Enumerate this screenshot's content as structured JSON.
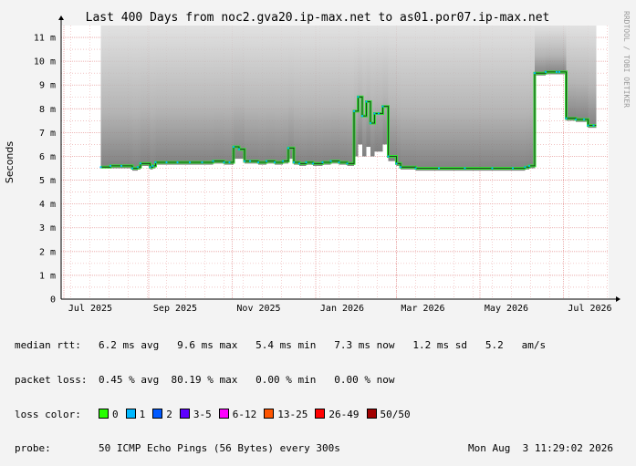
{
  "chart_data": {
    "type": "area",
    "title": "Last 400 Days from noc2.gva20.ip-max.net to as01.por07.ip-max.net",
    "ylabel": "Seconds",
    "vendor_label": "RRDTOOL / TOBI OETIKER",
    "ylim": [
      0,
      11.5
    ],
    "y_ticks": [
      {
        "value": 0,
        "label": "0"
      },
      {
        "value": 1,
        "label": "1 m"
      },
      {
        "value": 2,
        "label": "2 m"
      },
      {
        "value": 3,
        "label": "3 m"
      },
      {
        "value": 4,
        "label": "4 m"
      },
      {
        "value": 5,
        "label": "5 m"
      },
      {
        "value": 6,
        "label": "6 m"
      },
      {
        "value": 7,
        "label": "7 m"
      },
      {
        "value": 8,
        "label": "8 m"
      },
      {
        "value": 9,
        "label": "9 m"
      },
      {
        "value": 10,
        "label": "10 m"
      },
      {
        "value": 11,
        "label": "11 m"
      }
    ],
    "x_ticks": [
      {
        "date": "2025-07-01",
        "label": "Jul 2025"
      },
      {
        "date": "2025-09-01",
        "label": "Sep 2025"
      },
      {
        "date": "2025-11-01",
        "label": "Nov 2025"
      },
      {
        "date": "2026-01-01",
        "label": "Jan 2026"
      },
      {
        "date": "2026-03-01",
        "label": "Mar 2026"
      },
      {
        "date": "2026-05-01",
        "label": "May 2026"
      },
      {
        "date": "2026-07-01",
        "label": "Jul 2026"
      }
    ],
    "xlim": [
      "2025-06-29",
      "2026-08-03"
    ],
    "grid": true,
    "grid_color": "#e8a0a0",
    "median_color": "#33dd33",
    "series": [
      {
        "date": [
          "2025-07-28",
          "2025-08-04",
          "2025-08-12",
          "2025-08-20",
          "2025-08-24",
          "2025-08-26",
          "2025-09-02",
          "2025-09-04",
          "2025-09-06",
          "2025-09-14",
          "2025-09-22",
          "2025-10-01",
          "2025-10-10",
          "2025-10-18",
          "2025-10-26",
          "2025-10-30",
          "2025-11-02",
          "2025-11-06",
          "2025-11-10",
          "2025-11-14",
          "2025-11-20",
          "2025-11-26",
          "2025-12-02",
          "2025-12-08",
          "2025-12-12",
          "2025-12-16",
          "2025-12-20",
          "2025-12-25",
          "2025-12-30",
          "2026-01-06",
          "2026-01-12",
          "2026-01-18",
          "2026-01-24",
          "2026-01-29",
          "2026-02-01",
          "2026-02-04",
          "2026-02-07",
          "2026-02-10",
          "2026-02-13",
          "2026-02-16",
          "2026-02-19",
          "2026-02-23",
          "2026-03-01",
          "2026-03-04",
          "2026-03-15",
          "2026-04-01",
          "2026-04-20",
          "2026-05-10",
          "2026-05-25",
          "2026-06-03",
          "2026-06-06",
          "2026-06-10",
          "2026-06-18",
          "2026-06-26",
          "2026-06-28",
          "2026-07-03",
          "2026-07-10",
          "2026-07-16",
          "2026-07-19",
          "2026-07-23"
        ],
        "median": [
          5.55,
          5.6,
          5.6,
          5.5,
          5.55,
          5.7,
          5.55,
          5.6,
          5.75,
          5.75,
          5.75,
          5.75,
          5.75,
          5.8,
          5.75,
          5.75,
          6.4,
          6.3,
          5.8,
          5.8,
          5.75,
          5.8,
          5.75,
          5.8,
          6.35,
          5.75,
          5.7,
          5.75,
          5.7,
          5.75,
          5.8,
          5.75,
          5.7,
          7.9,
          8.5,
          7.7,
          8.3,
          7.4,
          7.8,
          7.8,
          8.1,
          6.0,
          5.7,
          5.55,
          5.5,
          5.5,
          5.5,
          5.5,
          5.5,
          5.55,
          5.6,
          9.5,
          9.55,
          9.55,
          9.55,
          7.6,
          7.55,
          7.55,
          7.3,
          7.3
        ],
        "upper": [
          11.5,
          11.5,
          11.5,
          11.5,
          11.5,
          11.5,
          11.5,
          11.5,
          11.5,
          11.5,
          11.5,
          11.5,
          11.5,
          11.5,
          11.5,
          11.5,
          11.5,
          11.5,
          11.5,
          11.5,
          11.5,
          11.5,
          11.5,
          11.5,
          11.5,
          11.5,
          11.5,
          11.5,
          11.5,
          11.5,
          11.5,
          11.5,
          11.5,
          11.5,
          11.5,
          11.5,
          11.5,
          11.5,
          11.5,
          11.5,
          11.5,
          11.5,
          11.5,
          11.5,
          11.5,
          11.5,
          11.5,
          11.5,
          11.5,
          11.5,
          11.5,
          11.5,
          11.5,
          11.5,
          11.5,
          11.5,
          11.5,
          11.5,
          11.5,
          11.5
        ],
        "lower": [
          5.5,
          5.5,
          5.5,
          5.4,
          5.45,
          5.6,
          5.45,
          5.5,
          5.65,
          5.65,
          5.65,
          5.65,
          5.65,
          5.7,
          5.65,
          5.65,
          5.9,
          5.9,
          5.7,
          5.7,
          5.65,
          5.7,
          5.65,
          5.7,
          5.9,
          5.65,
          5.6,
          5.65,
          5.6,
          5.65,
          5.7,
          5.65,
          5.6,
          6.0,
          6.5,
          6.0,
          6.4,
          6.0,
          6.2,
          6.2,
          6.5,
          5.8,
          5.6,
          5.45,
          5.4,
          5.4,
          5.4,
          5.4,
          5.4,
          5.45,
          5.5,
          9.4,
          9.45,
          9.45,
          9.45,
          7.5,
          7.45,
          7.45,
          7.2,
          7.2
        ]
      }
    ]
  },
  "stats": {
    "median_rtt": {
      "label": "median rtt:",
      "text": "6.2 ms avg   9.6 ms max   5.4 ms min   7.3 ms now   1.2 ms sd   5.2   am/s"
    },
    "packet_loss": {
      "label": "packet loss:",
      "text": "0.45 % avg  80.19 % max   0.00 % min   0.00 % now"
    },
    "loss_color": {
      "label": "loss color:",
      "items": [
        {
          "label": "0",
          "color": "#26ff00"
        },
        {
          "label": "1",
          "color": "#00b8ff"
        },
        {
          "label": "2",
          "color": "#0059ff"
        },
        {
          "label": "3-5",
          "color": "#5e00ff"
        },
        {
          "label": "6-12",
          "color": "#ff00ff"
        },
        {
          "label": "13-25",
          "color": "#ff5500"
        },
        {
          "label": "26-49",
          "color": "#ff0000"
        },
        {
          "label": "50/50",
          "color": "#a10000"
        }
      ]
    },
    "probe": {
      "label": "probe:",
      "text": "50 ICMP Echo Pings (56 Bytes) every 300s",
      "date": "Mon Aug  3 11:29:02 2026"
    }
  }
}
